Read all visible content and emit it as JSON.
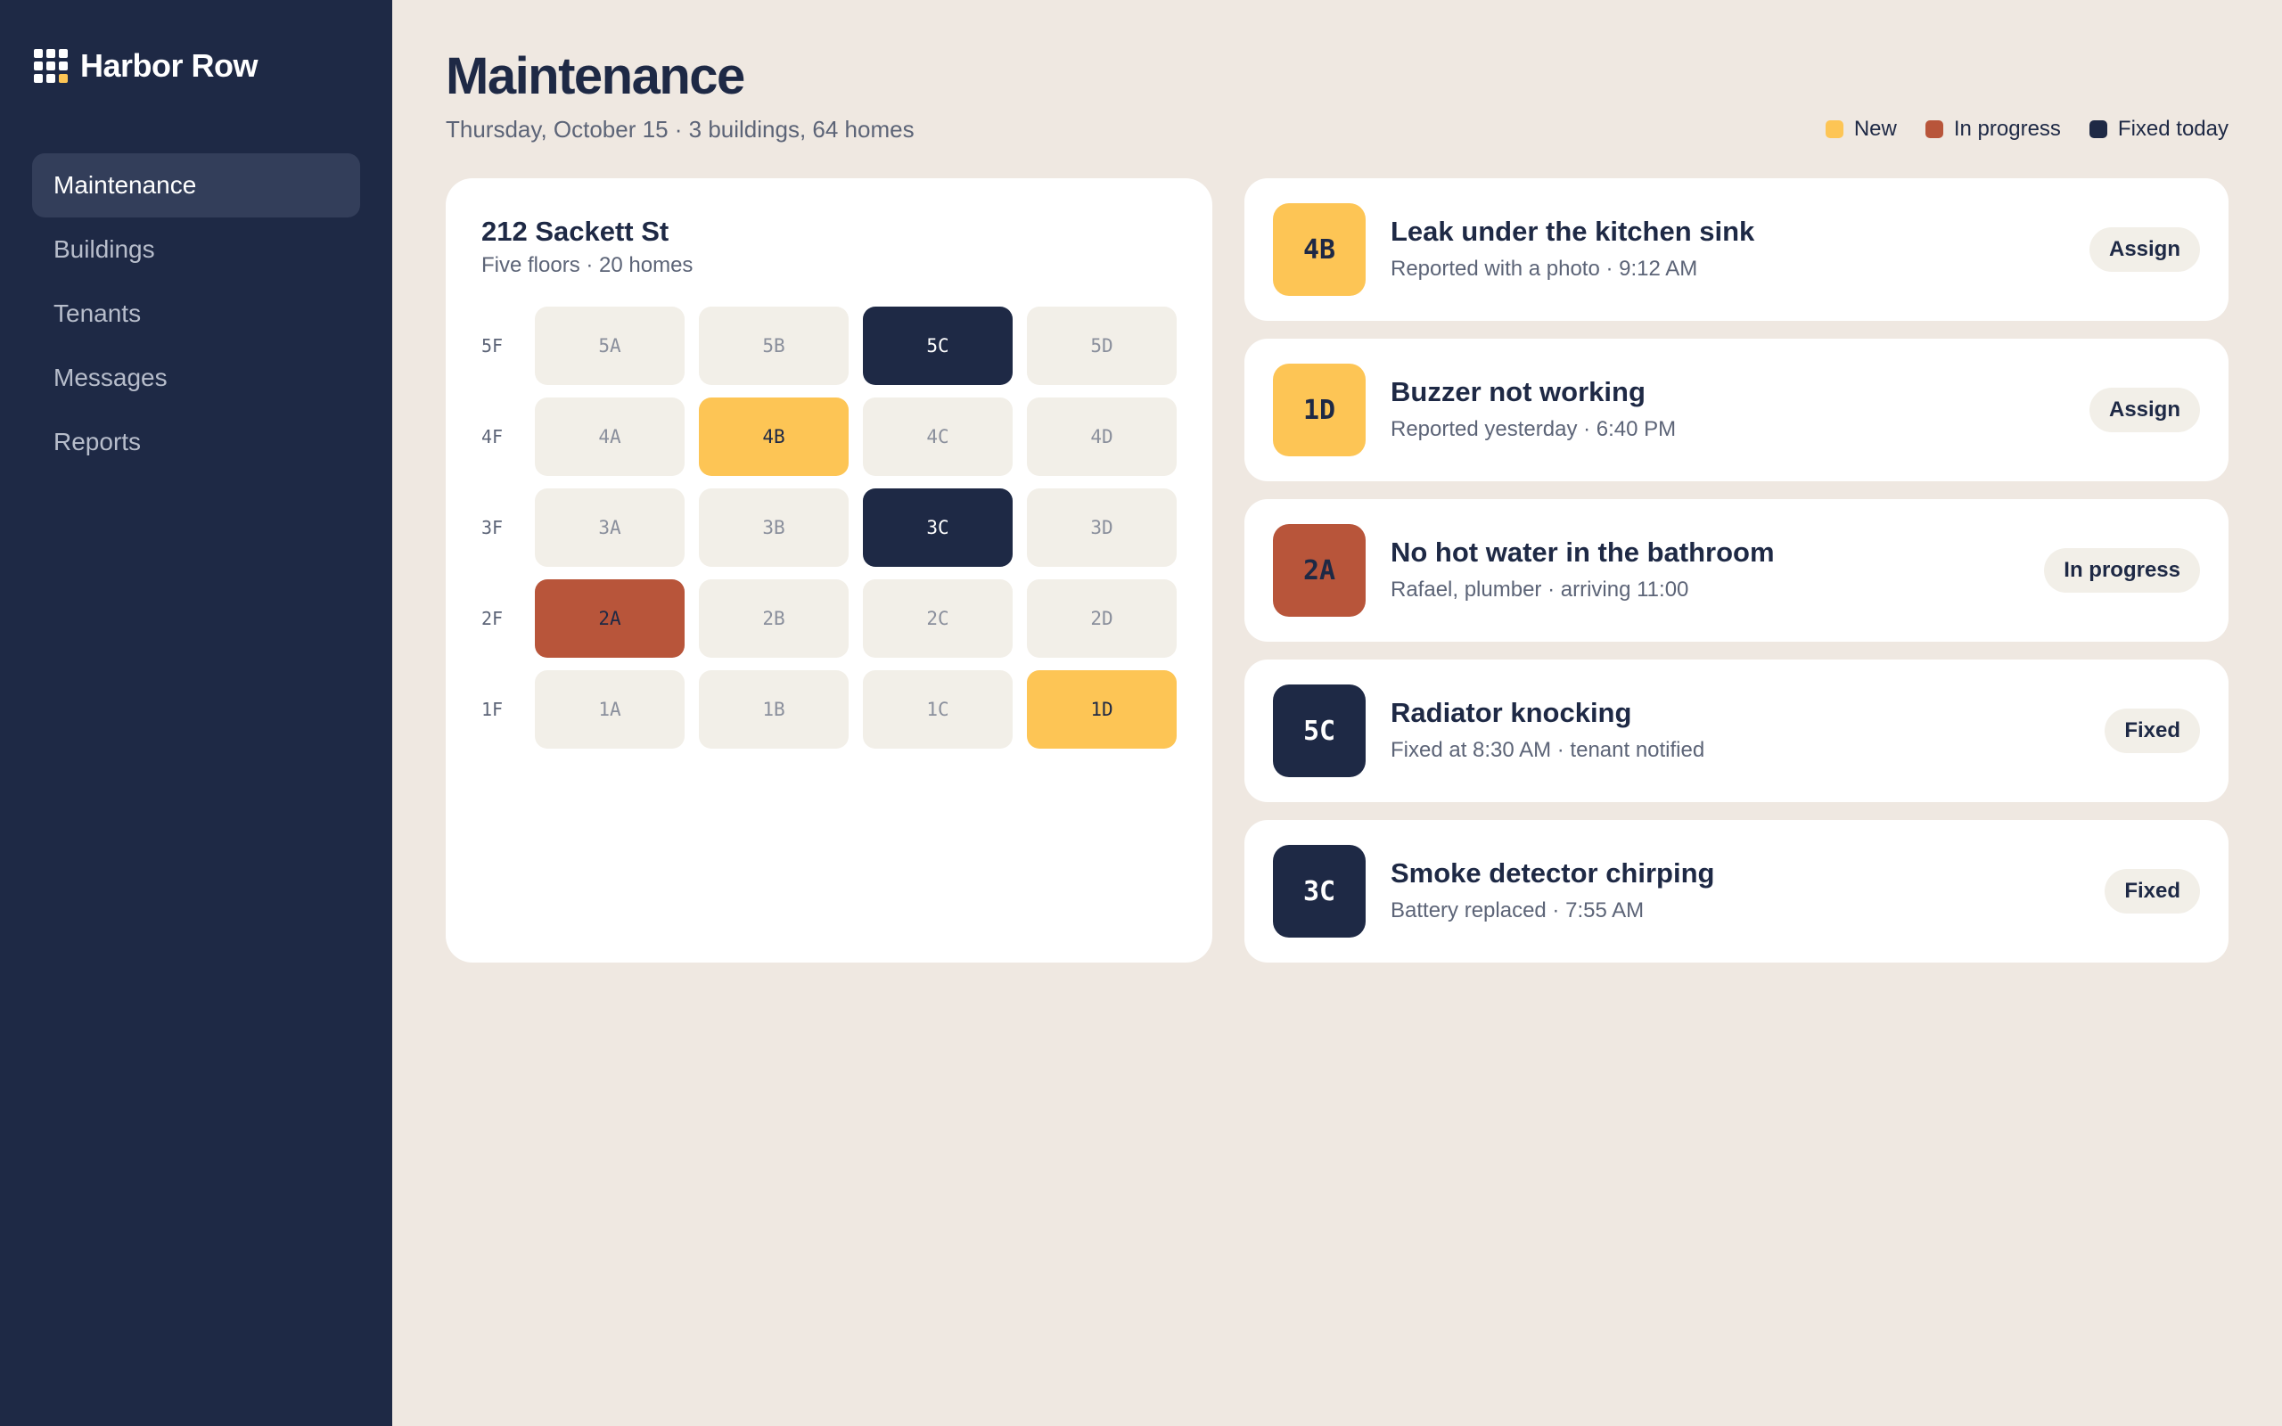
{
  "brand": {
    "name": "Harbor Row"
  },
  "sidebar": {
    "items": [
      {
        "label": "Maintenance"
      },
      {
        "label": "Buildings"
      },
      {
        "label": "Tenants"
      },
      {
        "label": "Messages"
      },
      {
        "label": "Reports"
      }
    ]
  },
  "header": {
    "title": "Maintenance",
    "subtitle": "Thursday, October 15 · 3 buildings, 64 homes"
  },
  "legend": [
    {
      "label": "New",
      "color": "#fdc555"
    },
    {
      "label": "In progress",
      "color": "#b8553a"
    },
    {
      "label": "Fixed today",
      "color": "#1e2945"
    }
  ],
  "building": {
    "name": "212 Sackett St",
    "summary": "Five floors · 20 homes",
    "floors": [
      {
        "label": "5F",
        "units": [
          {
            "id": "5A",
            "status": "none"
          },
          {
            "id": "5B",
            "status": "none"
          },
          {
            "id": "5C",
            "status": "fixed"
          },
          {
            "id": "5D",
            "status": "none"
          }
        ]
      },
      {
        "label": "4F",
        "units": [
          {
            "id": "4A",
            "status": "none"
          },
          {
            "id": "4B",
            "status": "new"
          },
          {
            "id": "4C",
            "status": "none"
          },
          {
            "id": "4D",
            "status": "none"
          }
        ]
      },
      {
        "label": "3F",
        "units": [
          {
            "id": "3A",
            "status": "none"
          },
          {
            "id": "3B",
            "status": "none"
          },
          {
            "id": "3C",
            "status": "fixed"
          },
          {
            "id": "3D",
            "status": "none"
          }
        ]
      },
      {
        "label": "2F",
        "units": [
          {
            "id": "2A",
            "status": "progress"
          },
          {
            "id": "2B",
            "status": "none"
          },
          {
            "id": "2C",
            "status": "none"
          },
          {
            "id": "2D",
            "status": "none"
          }
        ]
      },
      {
        "label": "1F",
        "units": [
          {
            "id": "1A",
            "status": "none"
          },
          {
            "id": "1B",
            "status": "none"
          },
          {
            "id": "1C",
            "status": "none"
          },
          {
            "id": "1D",
            "status": "new"
          }
        ]
      }
    ]
  },
  "tickets": [
    {
      "unit": "4B",
      "status": "new",
      "title": "Leak under the kitchen sink",
      "meta": "Reported with a photo · 9:12 AM",
      "action": "Assign"
    },
    {
      "unit": "1D",
      "status": "new",
      "title": "Buzzer not working",
      "meta": "Reported yesterday · 6:40 PM",
      "action": "Assign"
    },
    {
      "unit": "2A",
      "status": "progress",
      "title": "No hot water in the bathroom",
      "meta": "Rafael, plumber · arriving 11:00",
      "action": "In progress"
    },
    {
      "unit": "5C",
      "status": "fixed",
      "title": "Radiator knocking",
      "meta": "Fixed at 8:30 AM · tenant notified",
      "action": "Fixed"
    },
    {
      "unit": "3C",
      "status": "fixed",
      "title": "Smoke detector chirping",
      "meta": "Battery replaced · 7:55 AM",
      "action": "Fixed"
    }
  ]
}
